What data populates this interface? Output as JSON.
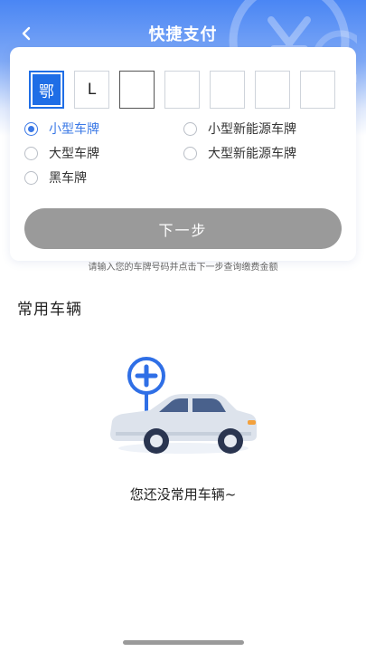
{
  "header": {
    "title": "快捷支付",
    "back_icon": "chevron-left-icon"
  },
  "plate": {
    "province": "鄂",
    "letter": "L",
    "chars": [
      "",
      "",
      "",
      "",
      ""
    ]
  },
  "plate_types": [
    {
      "label": "小型车牌",
      "selected": true
    },
    {
      "label": "小型新能源车牌",
      "selected": false
    },
    {
      "label": "大型车牌",
      "selected": false
    },
    {
      "label": "大型新能源车牌",
      "selected": false
    },
    {
      "label": "黑车牌",
      "selected": false
    }
  ],
  "next_button": {
    "label": "下一步"
  },
  "hint": "请输入您的车牌号码并点击下一步查询缴费金额",
  "frequent_vehicles": {
    "title": "常用车辆",
    "empty_text": "您还没常用车辆~"
  },
  "colors": {
    "accent": "#3a78e6",
    "plate_blue": "#1f6ee6",
    "button_disabled": "#9a9a9a"
  }
}
